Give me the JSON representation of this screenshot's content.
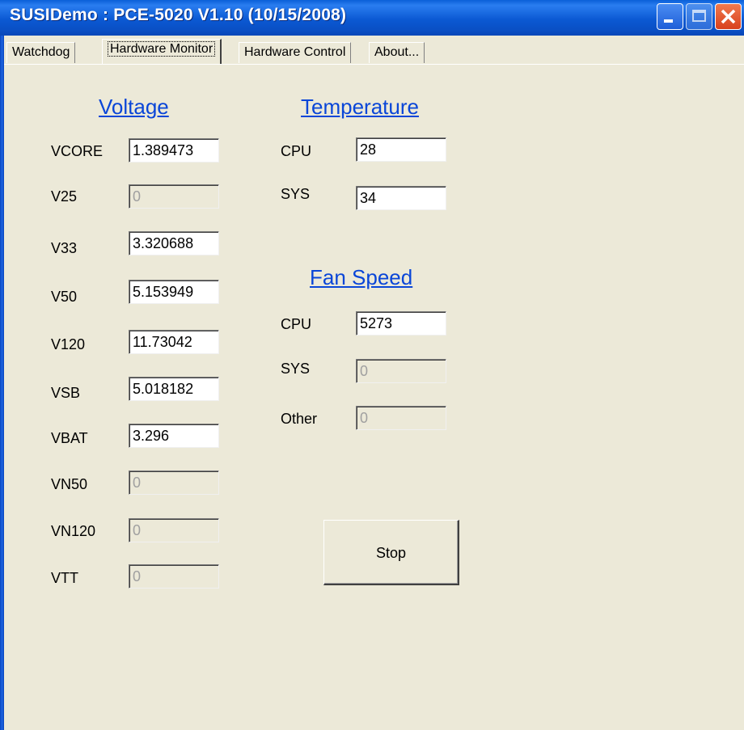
{
  "window": {
    "title": "SUSIDemo : PCE-5020 V1.10 (10/15/2008)"
  },
  "tabs": [
    {
      "label": "Watchdog"
    },
    {
      "label": "Hardware Monitor"
    },
    {
      "label": "Hardware Control"
    },
    {
      "label": "About..."
    }
  ],
  "voltage": {
    "header": "Voltage",
    "rows": [
      {
        "label": "VCORE",
        "value": "1.389473"
      },
      {
        "label": "V25",
        "value": "0"
      },
      {
        "label": "V33",
        "value": "3.320688"
      },
      {
        "label": "V50",
        "value": "5.153949"
      },
      {
        "label": "V120",
        "value": "11.73042"
      },
      {
        "label": "VSB",
        "value": "5.018182"
      },
      {
        "label": "VBAT",
        "value": "3.296"
      },
      {
        "label": "VN50",
        "value": "0"
      },
      {
        "label": "VN120",
        "value": "0"
      },
      {
        "label": "VTT",
        "value": "0"
      }
    ]
  },
  "temperature": {
    "header": "Temperature",
    "rows": [
      {
        "label": "CPU",
        "value": "28"
      },
      {
        "label": "SYS",
        "value": "34"
      }
    ]
  },
  "fan": {
    "header": "Fan Speed",
    "rows": [
      {
        "label": "CPU",
        "value": "5273"
      },
      {
        "label": "SYS",
        "value": "0"
      },
      {
        "label": "Other",
        "value": "0"
      }
    ]
  },
  "stop_label": "Stop"
}
